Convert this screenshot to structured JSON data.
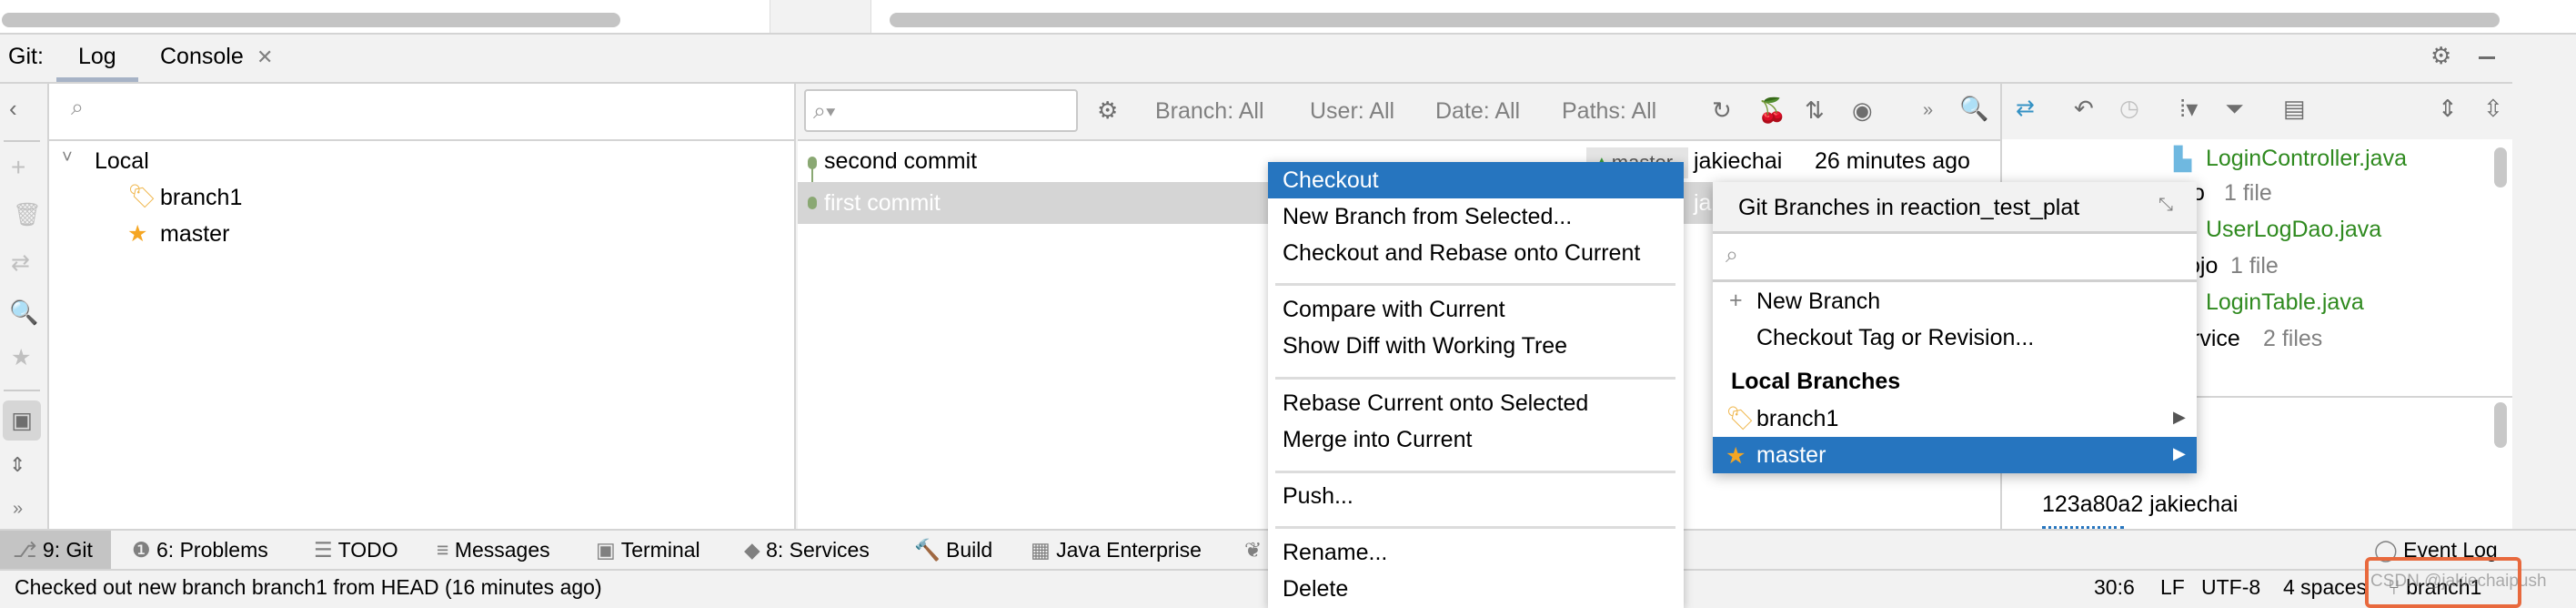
{
  "tabs": {
    "prefix": "Git:",
    "log": "Log",
    "console": "Console"
  },
  "branch_tree": {
    "root": "Local",
    "items": [
      "branch1",
      "master"
    ]
  },
  "filters": {
    "branch": "Branch: All",
    "user": "User: All",
    "date": "Date: All",
    "paths": "Paths: All"
  },
  "commits": [
    {
      "message": "second commit",
      "branch_label": "master",
      "author": "jakiechai",
      "time": "26 minutes ago"
    },
    {
      "message": "first commit",
      "author_partial": "ja"
    }
  ],
  "context_menu": {
    "items": [
      "Checkout",
      "New Branch from Selected...",
      "Checkout and Rebase onto Current",
      "Compare with Current",
      "Show Diff with Working Tree",
      "Rebase Current onto Selected",
      "Merge into Current",
      "Push...",
      "Rename...",
      "Delete"
    ],
    "selected": "Checkout"
  },
  "branches_popup": {
    "title": "Git Branches in reaction_test_plat",
    "new_branch": "New Branch",
    "checkout_tag": "Checkout Tag or Revision...",
    "section": "Local Branches",
    "branches": [
      "branch1",
      "master"
    ],
    "selected": "master"
  },
  "changed_files": [
    {
      "name": "LoginController.java"
    },
    {
      "dir": "o",
      "count": "1 file"
    },
    {
      "name": "UserLogDao.java"
    },
    {
      "dir": "ojo",
      "count": "1 file"
    },
    {
      "name": "LoginTable.java"
    },
    {
      "dir": "rvice",
      "count": "2 files"
    }
  ],
  "commit_details": {
    "hash_author": "123a80a2 jakiechai"
  },
  "tool_windows": [
    "9: Git",
    "6: Problems",
    "TODO",
    "Messages",
    "Terminal",
    "8: Services",
    "Build",
    "Java Enterprise"
  ],
  "event_log": "Event Log",
  "status": {
    "message": "Checked out new branch branch1 from HEAD (16 minutes ago)",
    "position": "30:6",
    "line_sep": "LF",
    "encoding": "UTF-8",
    "indent": "4 spaces",
    "branch": "branch1",
    "watermark": "CSDN @jakiechaipush"
  },
  "colors": {
    "selection": "#2675bf",
    "highlight_box": "#e8693d",
    "file_modified": "#2f8a1f",
    "commit_node": "#8aa873"
  }
}
